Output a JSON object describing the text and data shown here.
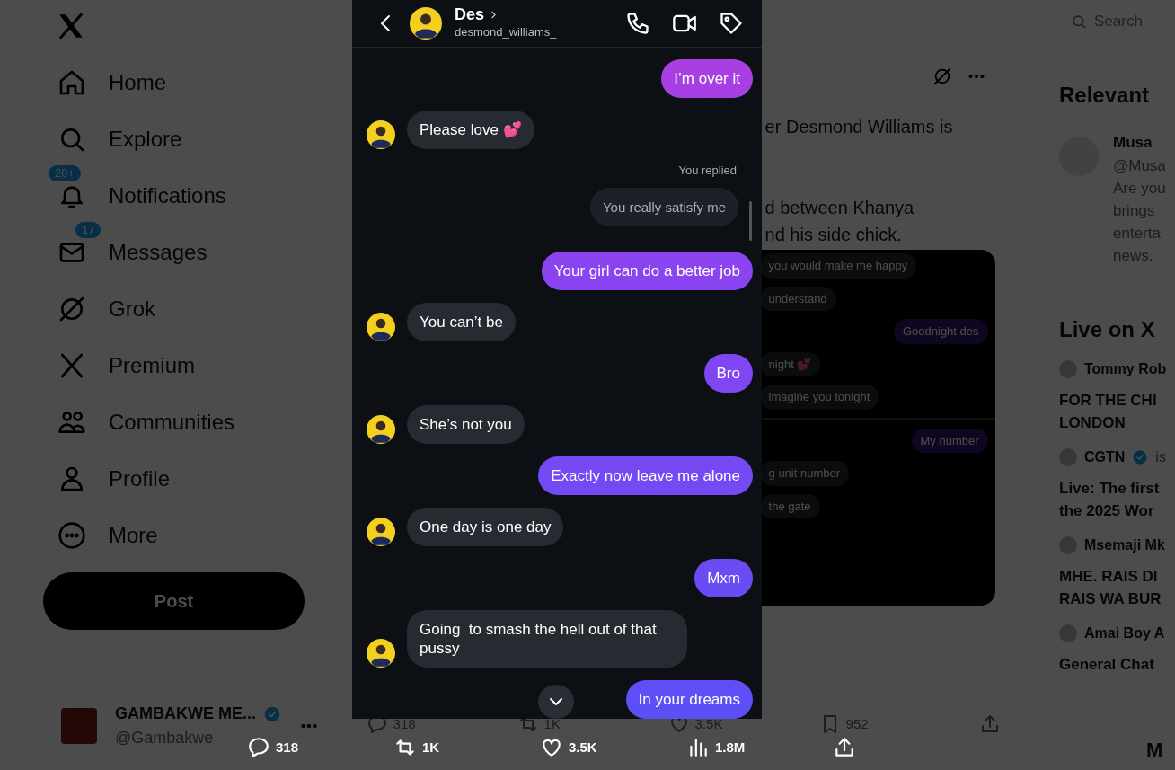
{
  "sidebar": {
    "items": [
      {
        "label": "Home"
      },
      {
        "label": "Explore"
      },
      {
        "label": "Notifications",
        "badge": "20+"
      },
      {
        "label": "Messages",
        "badge": "17"
      },
      {
        "label": "Grok"
      },
      {
        "label": "Premium"
      },
      {
        "label": "Communities"
      },
      {
        "label": "Profile"
      },
      {
        "label": "More"
      }
    ],
    "post_button": "Post",
    "account": {
      "name": "GAMBAKWE ME...",
      "handle": "@Gambakwe",
      "verified": true
    }
  },
  "post": {
    "text_lines": [
      "er Desmond Williams is",
      "d between Khanya",
      "nd his side chick."
    ],
    "image_messages": [
      {
        "kind": "received",
        "text": "you would make me happy"
      },
      {
        "kind": "received",
        "text": "understand"
      },
      {
        "kind": "sent",
        "text": "Goodnight des"
      },
      {
        "kind": "received",
        "text": "night 💕"
      },
      {
        "kind": "received",
        "text": "imagine you tonight"
      },
      {
        "kind": "divider"
      },
      {
        "kind": "sent",
        "text": "My number"
      },
      {
        "kind": "received",
        "text": "g unit number"
      },
      {
        "kind": "received",
        "text": "the gate"
      }
    ],
    "actions": [
      {
        "kind": "reply",
        "count": "318"
      },
      {
        "kind": "repost",
        "count": "1K"
      },
      {
        "kind": "like",
        "count": "3.5K"
      },
      {
        "kind": "bookmark",
        "count": "952"
      },
      {
        "kind": "share"
      }
    ]
  },
  "right": {
    "search": {
      "placeholder": "Search"
    },
    "relevant": {
      "heading": "Relevant",
      "person": {
        "name": "Musa",
        "handle": "@Musa",
        "bio_lines": [
          "Are you",
          "brings",
          "enterta",
          "news."
        ]
      }
    },
    "live": {
      "heading": "Live on X",
      "items": [
        {
          "host": "Tommy Rob",
          "verified": false,
          "title_lines": [
            "FOR THE CHI",
            "LONDON"
          ]
        },
        {
          "host": "CGTN",
          "verified": true,
          "suffix": "is",
          "title_lines": [
            "Live: The first",
            "the 2025 Wor"
          ]
        },
        {
          "host": "Msemaji Mk",
          "verified": false,
          "title_lines": [
            "MHE. RAIS DI",
            "RAIS WA BUR"
          ]
        },
        {
          "host": "Amai Boy A",
          "verified": false,
          "title_lines": [
            "General Chat"
          ]
        }
      ]
    },
    "drawer": "M"
  },
  "viewer": {
    "header": {
      "name": "Des",
      "username": "desmond_williams_"
    },
    "messages": [
      {
        "kind": "received_hidden"
      },
      {
        "kind": "sent",
        "text": "I’m over it"
      },
      {
        "kind": "received",
        "text": "Please love 💕"
      },
      {
        "kind": "reply_note",
        "text": "You replied"
      },
      {
        "kind": "replied_to",
        "text": "You really satisfy me"
      },
      {
        "kind": "sent",
        "text": "Your girl can do a better job"
      },
      {
        "kind": "received",
        "text": "You can’t be"
      },
      {
        "kind": "sent",
        "text": "Bro"
      },
      {
        "kind": "received",
        "text": "She’s not you"
      },
      {
        "kind": "sent",
        "text": "Exactly now leave me alone"
      },
      {
        "kind": "received",
        "text": "One day is one day"
      },
      {
        "kind": "sent",
        "text": "Mxm"
      },
      {
        "kind": "received",
        "text": "Going  to smash the hell out of that pussy"
      },
      {
        "kind": "sent",
        "text": "In your dreams"
      }
    ],
    "actions": [
      {
        "kind": "reply",
        "count": "318"
      },
      {
        "kind": "repost",
        "count": "1K"
      },
      {
        "kind": "like",
        "count": "3.5K"
      },
      {
        "kind": "views",
        "count": "1.8M"
      },
      {
        "kind": "share"
      }
    ]
  }
}
